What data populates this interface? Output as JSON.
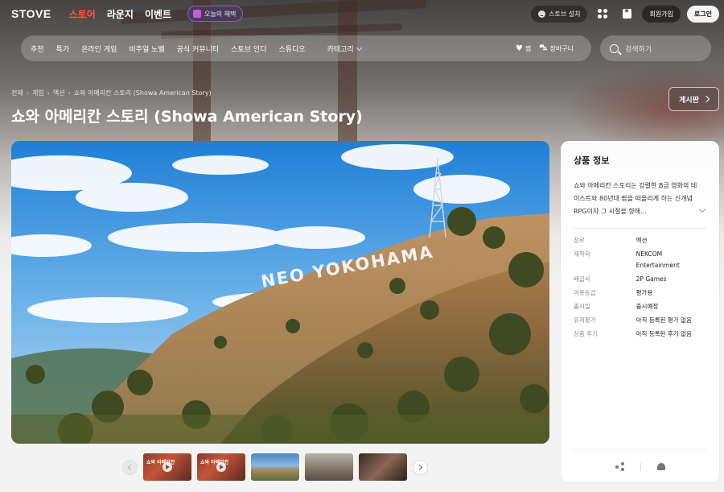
{
  "header": {
    "logo": "STOVE",
    "nav": [
      "스토어",
      "라운지",
      "이벤트"
    ],
    "active_nav": "스토어",
    "today_badge": "오늘의 혜택",
    "install_label": "스토브 설치",
    "signup_label": "회원가입",
    "login_label": "로그인"
  },
  "categories": {
    "items": [
      "추천",
      "특가",
      "온라인 게임",
      "비주얼 노벨",
      "공식 커뮤니티",
      "스토브 인디",
      "스튜디오",
      "카테고리"
    ],
    "wishlist_label": "찜",
    "cart_label": "장바구니"
  },
  "search": {
    "placeholder": "검색하기"
  },
  "breadcrumb": [
    "전체",
    "게임",
    "액션",
    "쇼와 아메리칸 스토리 (Showa American Story)"
  ],
  "title": "쇼와 아메리칸 스토리 (Showa American Story)",
  "board_button": "게시판",
  "screenshot": {
    "sign_text": "NEO YOKOHAMA"
  },
  "thumbnail_caption": "쇼와 아메리칸",
  "info": {
    "title": "상품 정보",
    "description": "쇼와 아메리칸 스토리는 강렬한 B급 영화의 테이스트와 80년대 팝을 떠올리게 하는 신개념 RPG이자 그 시절을 향해…",
    "rows": [
      {
        "key": "장르",
        "value": "액션"
      },
      {
        "key": "제작자",
        "value": "NEKCOM Entertainment"
      },
      {
        "key": "배급사",
        "value": "2P Games"
      },
      {
        "key": "이용등급",
        "value": "평가용"
      },
      {
        "key": "출시일",
        "value": "출시예정"
      },
      {
        "key": "유저평가",
        "value": "아직 등록된 평가 없음"
      },
      {
        "key": "상품 후기",
        "value": "아직 등록된 후기 없음"
      }
    ]
  },
  "colors": {
    "accent": "#ff5a3c",
    "badge": "#8a5fb5"
  }
}
